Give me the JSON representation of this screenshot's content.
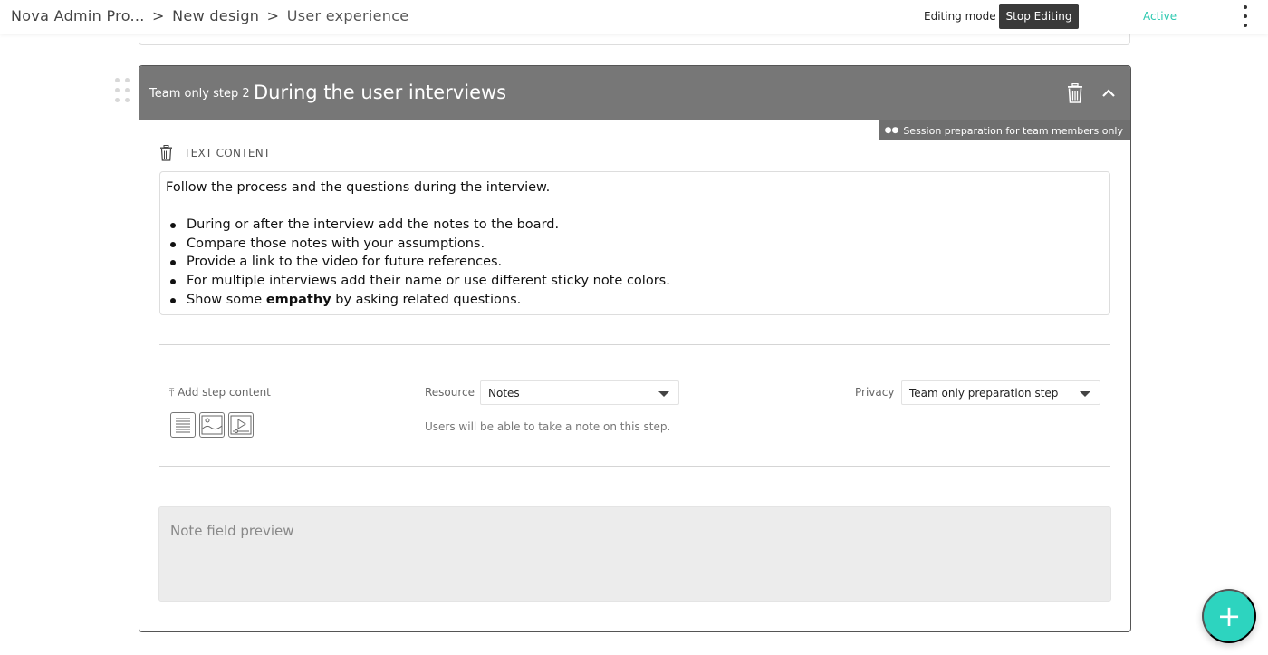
{
  "breadcrumb": {
    "root": "Nova Admin Pro...",
    "sep1": ">",
    "mid": "New design",
    "sep2": ">",
    "last": "User experience"
  },
  "toolbar": {
    "editing_mode_label": "Editing mode",
    "stop_editing_label": "Stop Editing",
    "status": "Active",
    "menu_icon": "vertical-dots-icon"
  },
  "step": {
    "number_label": "Team only step 2",
    "title": "During the user interviews",
    "privacy_tag": "Session preparation for team members only",
    "text_content_label": "TEXT CONTENT",
    "intro": "Follow the process and the questions during the interview.",
    "bullets": [
      "During or after the interview add the notes to the board.",
      "Compare those notes with your assumptions.",
      "Provide a link to the video for future references.",
      "For multiple interviews add their name or use different sticky note colors."
    ],
    "last_bullet": {
      "before": "Show some ",
      "bold": "empathy",
      "after": " by asking related questions."
    },
    "add_step_content": "⤒ Add step content",
    "content_types": [
      "text-icon",
      "image-icon",
      "video-icon"
    ],
    "resource_label": "Resource",
    "resource_value": "Notes",
    "resource_hint": "Users will be able to take a note on this step.",
    "privacy_label": "Privacy",
    "privacy_value": "Team only preparation step",
    "note_preview": "Note field preview"
  },
  "fab": {
    "label": "+"
  },
  "colors": {
    "header_bg": "#777777",
    "accent": "#2dd4bf",
    "active": "#2cc9b0",
    "stop_button": "#3a3a3a"
  }
}
